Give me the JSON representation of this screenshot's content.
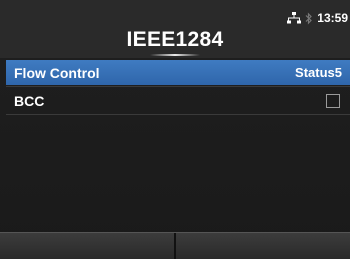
{
  "header": {
    "title": "IEEE1284",
    "clock": "13:59",
    "icons": [
      "network-icon",
      "bluetooth-icon"
    ]
  },
  "menu": {
    "items": [
      {
        "label": "Flow Control",
        "value": "Status5",
        "selected": true
      },
      {
        "label": "BCC",
        "checked": false,
        "selected": false
      }
    ]
  },
  "softkeys": {
    "left": "",
    "right": ""
  },
  "colors": {
    "accent": "#3f7bc1",
    "background": "#1a1a1a"
  }
}
